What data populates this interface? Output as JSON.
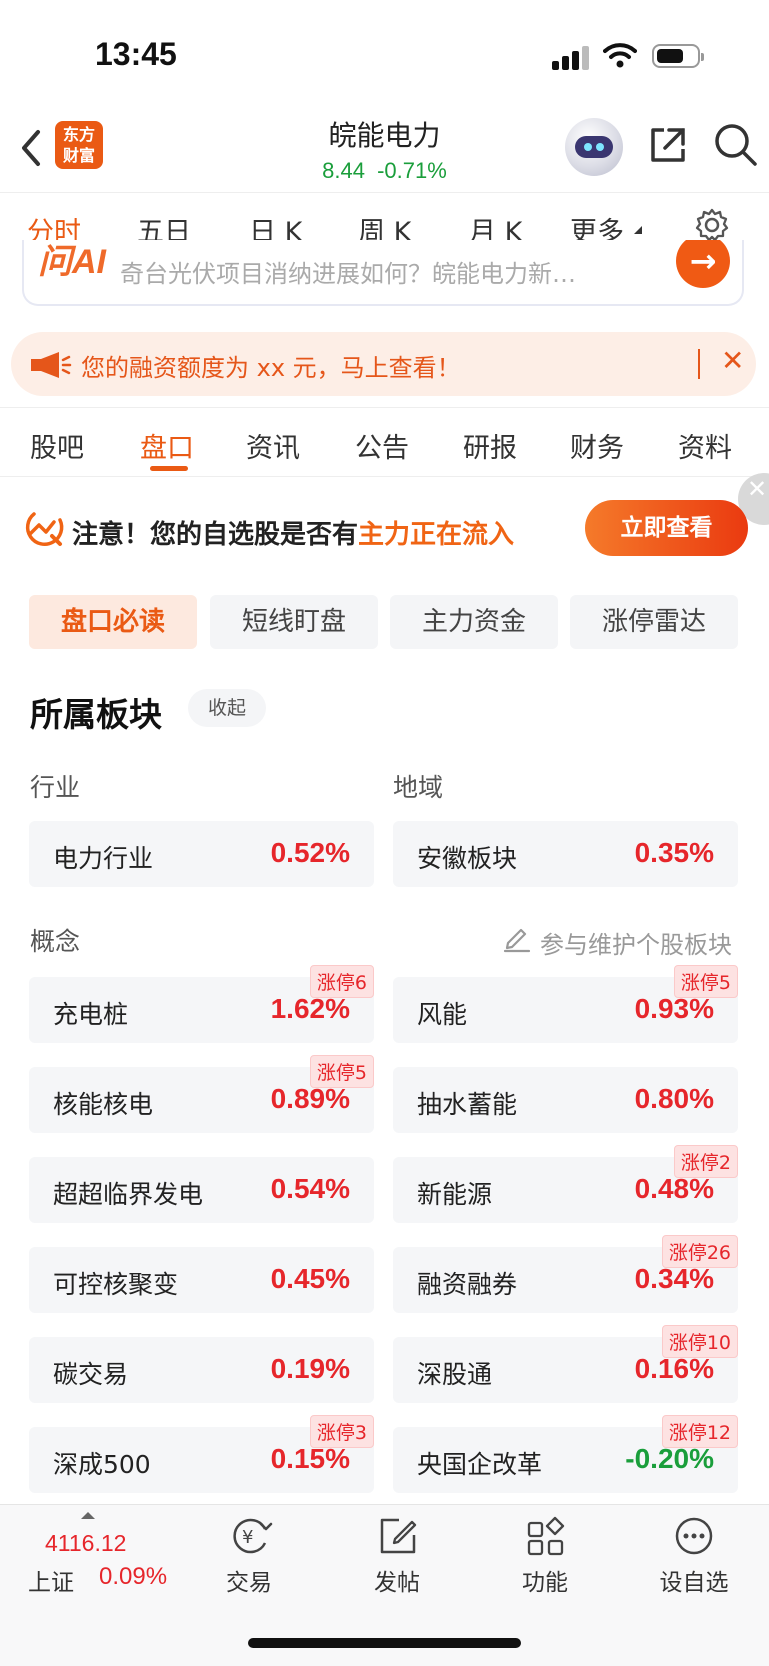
{
  "status_bar": {
    "time": "13:45"
  },
  "header": {
    "logo_text_line1": "东方",
    "logo_text_line2": "财富",
    "stock_name": "皖能电力",
    "price": "8.44",
    "change_pct": "-0.71%"
  },
  "ktabs": [
    "分时",
    "五日",
    "日 K",
    "周 K",
    "月 K",
    "更多"
  ],
  "ai_bar": {
    "logo": "问AI",
    "prompt": "奇台光伏项目消纳进展如何？皖能电力新…",
    "arrow": "→"
  },
  "notice": {
    "message": "您的融资额度为 xx 元，马上查看！",
    "close": "✕"
  },
  "tabs2": [
    "股吧",
    "盘口",
    "资讯",
    "公告",
    "研报",
    "财务",
    "资料"
  ],
  "banner": {
    "text_prefix": "注意！您的自选股是否有",
    "text_highlight": "主力正在流入",
    "button": "立即查看",
    "close": "✕"
  },
  "subtabs": [
    "盘口必读",
    "短线盯盘",
    "主力资金",
    "涨停雷达"
  ],
  "section": {
    "title": "所属板块",
    "collapse": "收起",
    "industry_label": "行业",
    "region_label": "地域",
    "concept_label": "概念",
    "maintain": "参与维护个股板块"
  },
  "industry": {
    "name": "电力行业",
    "pct": "0.52%"
  },
  "region": {
    "name": "安徽板块",
    "pct": "0.35%"
  },
  "concepts": [
    {
      "name": "充电桩",
      "pct": "1.62%",
      "badge": "涨停6"
    },
    {
      "name": "风能",
      "pct": "0.93%",
      "badge": "涨停5"
    },
    {
      "name": "核能核电",
      "pct": "0.89%",
      "badge": "涨停5"
    },
    {
      "name": "抽水蓄能",
      "pct": "0.80%",
      "badge": ""
    },
    {
      "name": "超超临界发电",
      "pct": "0.54%",
      "badge": ""
    },
    {
      "name": "新能源",
      "pct": "0.48%",
      "badge": "涨停2"
    },
    {
      "name": "可控核聚变",
      "pct": "0.45%",
      "badge": ""
    },
    {
      "name": "融资融券",
      "pct": "0.34%",
      "badge": "涨停26"
    },
    {
      "name": "碳交易",
      "pct": "0.19%",
      "badge": ""
    },
    {
      "name": "深股通",
      "pct": "0.16%",
      "badge": "涨停10"
    },
    {
      "name": "深成500",
      "pct": "0.15%",
      "badge": "涨停3"
    },
    {
      "name": "央国企改革",
      "pct": "-0.20%",
      "badge": "涨停12"
    }
  ],
  "bottom": {
    "index_value": "4116.12",
    "index_name": "上证",
    "index_pct": "0.09%",
    "nav": [
      "交易",
      "发帖",
      "功能",
      "设自选"
    ]
  },
  "colors": {
    "accent": "#ea5a14",
    "up": "#e6262b",
    "down": "#1a9e3b"
  }
}
